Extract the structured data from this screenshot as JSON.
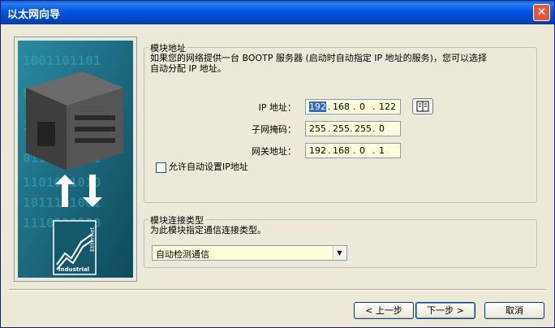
{
  "window": {
    "title": "以太网向导",
    "close_glyph": "✕"
  },
  "image": {
    "digits": [
      "1001101101",
      "0101001010",
      "1010110101",
      "0110100110",
      "1101011010",
      "1011101001",
      "1110110100"
    ],
    "logo_text": "Industrial",
    "logo_text_vertical": "Ethernet"
  },
  "module_address": {
    "legend": "模块地址",
    "description_line1": "如果您的网络提供一台 BOOTP 服务器 (启动时自动指定 IP 地址的服务)，您可以选择",
    "description_line2": "自动分配 IP 地址。",
    "ip": {
      "label": "IP 地址：",
      "octets": [
        "192",
        "168",
        "0",
        "122"
      ]
    },
    "subnet": {
      "label": "子网掩码：",
      "octets": [
        "255",
        "255",
        "255",
        "0"
      ]
    },
    "gateway": {
      "label": "网关地址：",
      "octets": [
        "192",
        "168",
        "0",
        "1"
      ]
    },
    "dot": ".",
    "auto_checkbox_label": "允许自动设置IP地址"
  },
  "connection_type": {
    "legend": "模块连接类型",
    "description": "为此模块指定通信连接类型。",
    "selected": "自动检测通信",
    "arrow": "▼"
  },
  "buttons": {
    "back": "< 上一步",
    "next": "下一步 >",
    "cancel": "取消"
  },
  "colors": {
    "title_bar": "#0055e5",
    "input_bg": "#ffffd9",
    "image_bg": "#1c6b80",
    "selection": "#316ac5"
  }
}
